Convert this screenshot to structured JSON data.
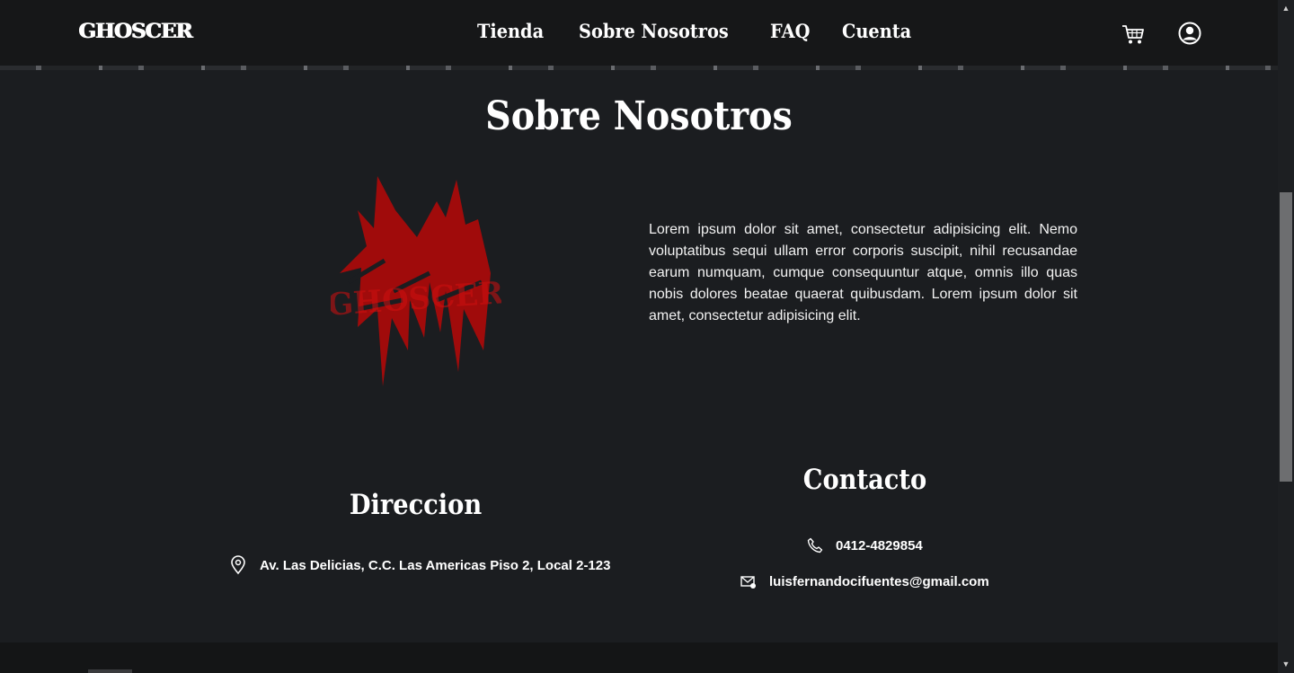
{
  "nav": {
    "brand": "GHOSCER",
    "links": [
      "Tienda",
      "Sobre Nosotros",
      "FAQ",
      "Cuenta"
    ],
    "icons": {
      "cart": "cart-icon",
      "account": "user-circle-icon"
    }
  },
  "about": {
    "title": "Sobre Nosotros",
    "logo_text": "GHOSCER",
    "text": "Lorem ipsum dolor sit amet, consectetur adipisicing elit. Nemo voluptatibus sequi ullam error corporis suscipit, nihil recusandae earum numquam, cumque consequuntur atque, omnis illo quas nobis dolores beatae quaerat quibusdam. Lorem ipsum dolor sit amet, consectetur adipisicing elit."
  },
  "direccion": {
    "title": "Direccion",
    "address": "Av. Las Delicias, C.C. Las Americas Piso 2, Local 2-123"
  },
  "contacto": {
    "title": "Contacto",
    "phone": "0412-4829854",
    "email": "luisfernandocifuentes@gmail.com"
  },
  "colors": {
    "background": "#1b1d20",
    "navbar": "#161718",
    "logo_red": "#a80b0b",
    "text": "#ffffff"
  }
}
